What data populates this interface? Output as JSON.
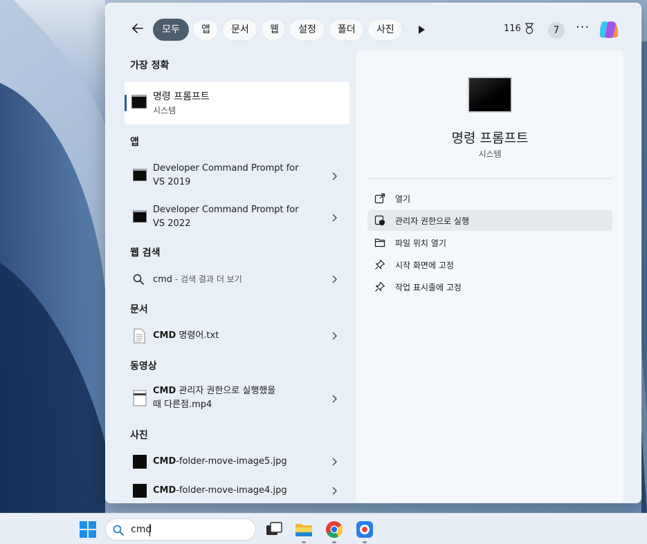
{
  "filter_bar": {
    "chips": [
      "모두",
      "앱",
      "문서",
      "웹",
      "설정",
      "폴더",
      "사진"
    ],
    "active_chip": "모두",
    "points": "116",
    "badge_count": "7"
  },
  "results": {
    "best_match": {
      "heading": "가장 정확",
      "title": "명령 프롬프트",
      "subtitle": "시스템"
    },
    "apps": {
      "heading": "앱",
      "items": [
        {
          "title_line1": "Developer Command Prompt for",
          "title_line2": "VS 2019"
        },
        {
          "title_line1": "Developer Command Prompt for",
          "title_line2": "VS 2022"
        }
      ]
    },
    "web": {
      "heading": "웹 검색",
      "query": "cmd",
      "suffix": " - 검색 결과 더 보기"
    },
    "documents": {
      "heading": "문서",
      "item_bold": "CMD",
      "item_rest": " 명령어.txt"
    },
    "videos": {
      "heading": "동영상",
      "item_bold": "CMD",
      "item_rest": " 관리자 권한으로 실행했을",
      "item_line2": "때 다른점.mp4"
    },
    "photos": {
      "heading": "사진",
      "items": [
        {
          "bold": "CMD",
          "rest": "-folder-move-image5.jpg"
        },
        {
          "bold": "CMD",
          "rest": "-folder-move-image4.jpg"
        }
      ]
    }
  },
  "detail": {
    "title": "명령 프롬프트",
    "subtitle": "시스템",
    "actions": [
      "열기",
      "관리자 권한으로 실행",
      "파일 위치 열기",
      "시작 화면에 고정",
      "작업 표시줄에 고정"
    ],
    "hovered_action": "관리자 권한으로 실행"
  },
  "taskbar": {
    "search_value": "cmd"
  },
  "colors": {
    "active_chip": "#4c5d6e",
    "accent": "#2b5a8e",
    "copilot": [
      "#36c5f0",
      "#a355e6",
      "#f5913e"
    ]
  }
}
